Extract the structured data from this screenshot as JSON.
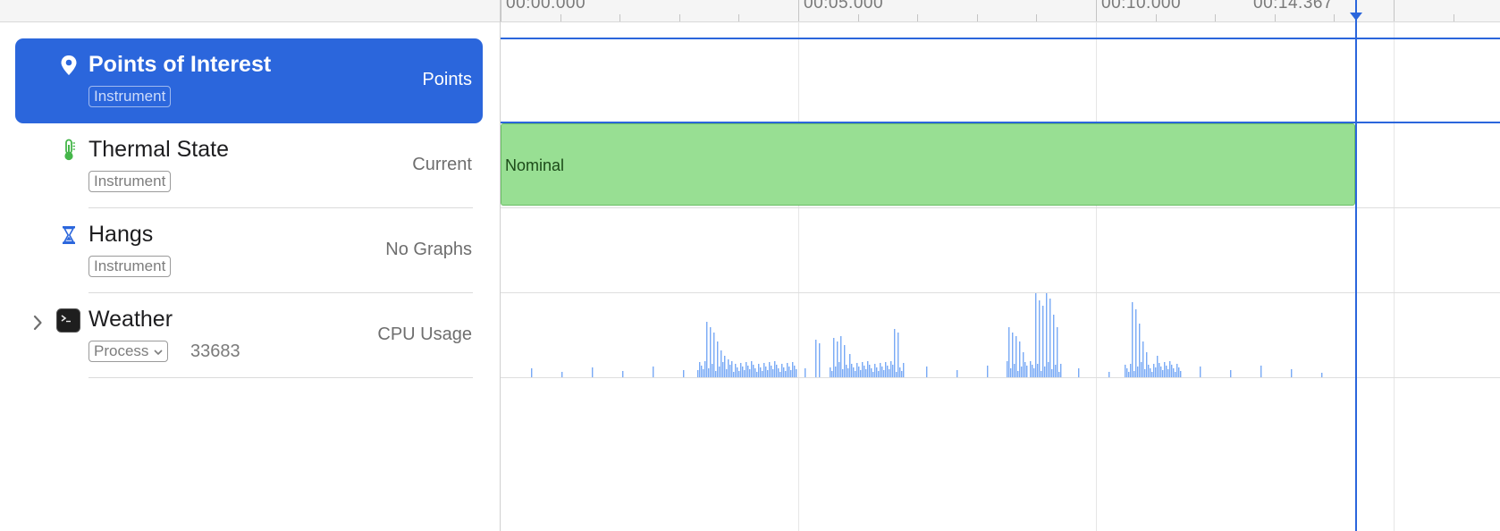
{
  "ruler": {
    "labels": [
      "00:00.000",
      "00:05.000",
      "00:10.000",
      "00:14.367"
    ]
  },
  "tracks": [
    {
      "title": "Points of Interest",
      "type": "Instrument",
      "caption": "Points",
      "icon": "pin-icon",
      "selected": true
    },
    {
      "title": "Thermal State",
      "type": "Instrument",
      "caption": "Current",
      "icon": "thermometer-icon",
      "selected": false
    },
    {
      "title": "Hangs",
      "type": "Instrument",
      "caption": "No Graphs",
      "icon": "hourglass-icon",
      "selected": false
    },
    {
      "title": "Weather",
      "type": "Process",
      "pid": "33683",
      "caption": "CPU Usage",
      "icon": "terminal-app-icon",
      "selected": false
    }
  ],
  "thermal": {
    "state": "Nominal"
  },
  "colors": {
    "accent": "#2b66dc",
    "thermal_nominal": "#98df93",
    "cpu_bar": "#78a9f5"
  }
}
